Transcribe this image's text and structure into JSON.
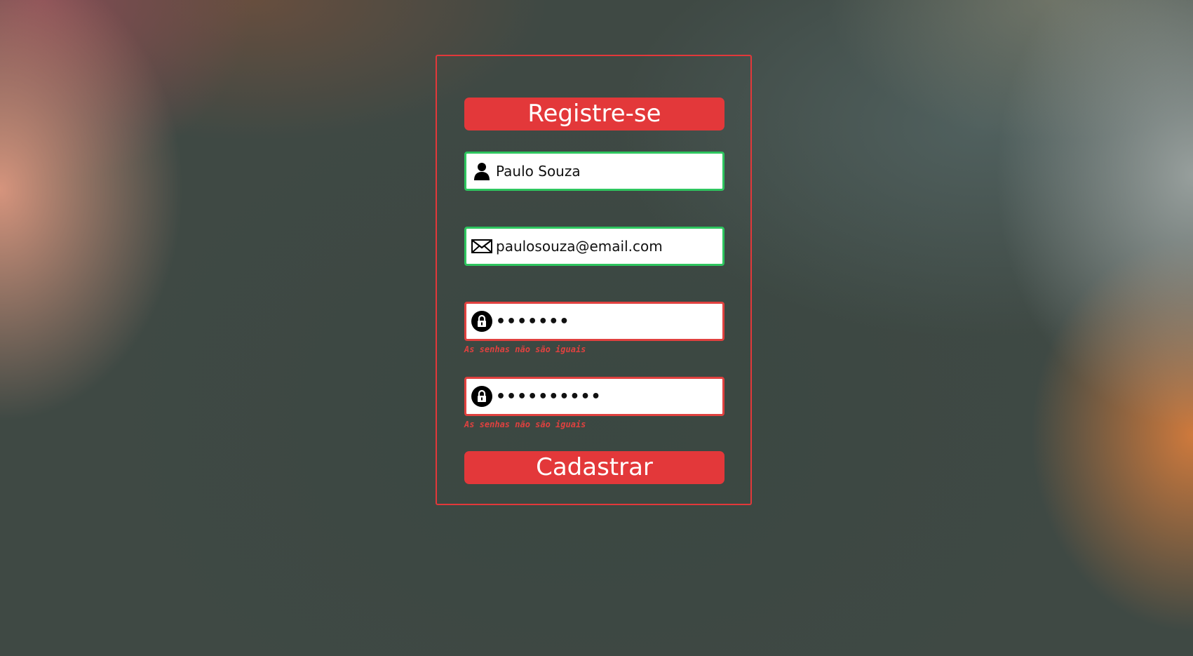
{
  "form": {
    "title": "Registre-se",
    "fields": [
      {
        "value": "Paulo Souza",
        "icon": "user-icon",
        "state": "valid",
        "border_color": "#2ec55f"
      },
      {
        "value": "paulosouza@email.com",
        "icon": "envelope-icon",
        "state": "valid",
        "border_color": "#2ec55f"
      },
      {
        "value": "•••••••",
        "icon": "lock-icon",
        "state": "invalid",
        "border_color": "#e0413f",
        "error": "As senhas não são iguais"
      },
      {
        "value": "••••••••••",
        "icon": "lock-icon",
        "state": "invalid",
        "border_color": "#e0413f",
        "error": "As senhas não são iguais"
      }
    ],
    "submit_label": "Cadastrar"
  },
  "colors": {
    "accent": "#e3383a",
    "valid": "#2ec55f",
    "error": "#e0413f"
  }
}
